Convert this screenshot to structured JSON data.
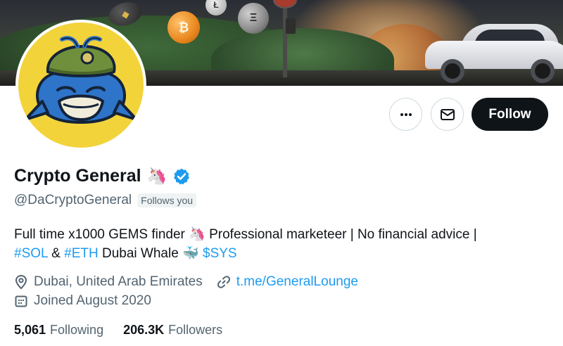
{
  "profile": {
    "display_name": "Crypto General",
    "name_emoji": "🦄",
    "handle": "@DaCryptoGeneral",
    "follows_you": "Follows you",
    "bio": {
      "line1_text": "Full time x1000 GEMS finder ",
      "line1_emoji": "🦄",
      "line1_rest": " Professional marketeer | No financial advice |",
      "tag_sol": "#SOL",
      "amp": " & ",
      "tag_eth": "#ETH",
      "dubai": " Dubai Whale ",
      "whale_emoji": "🐳",
      "tag_sys": "$SYS"
    },
    "location": "Dubai, United Arab Emirates",
    "link": "t.me/GeneralLounge",
    "joined": "Joined August 2020",
    "following_count": "5,061",
    "following_label": "Following",
    "followers_count": "206.3K",
    "followers_label": "Followers"
  },
  "actions": {
    "follow_label": "Follow",
    "more_icon": "more-icon",
    "message_icon": "envelope-icon"
  },
  "banner": {
    "coin_btc": "₿",
    "coin_bnb": "◆",
    "coin_eth": "Ξ",
    "coin_ltc": "Ł"
  },
  "colors": {
    "accent": "#1d9bf0",
    "text_primary": "#0f1419",
    "text_secondary": "#536471",
    "follow_bg": "#0f1419",
    "avatar_bg": "#f2d33a"
  }
}
